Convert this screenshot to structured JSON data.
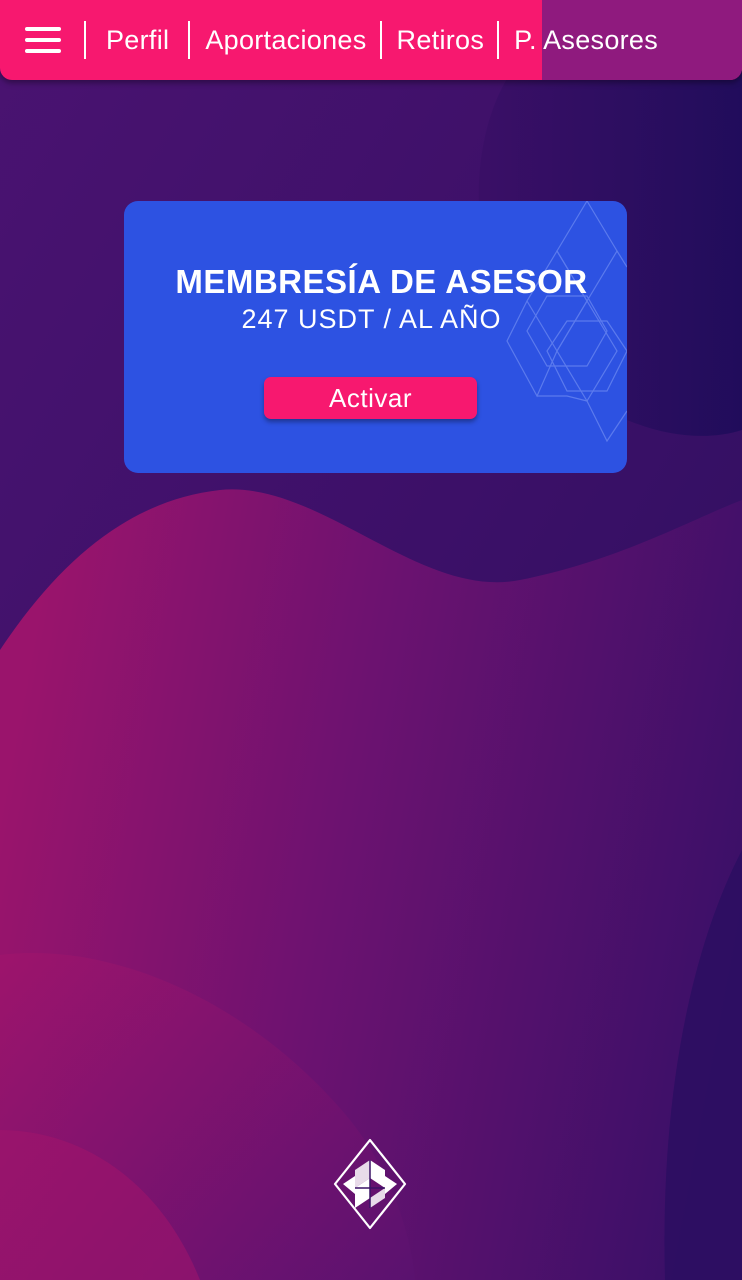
{
  "nav": {
    "menu_icon": "hamburger-menu-icon",
    "tabs": [
      {
        "label": "Perfil"
      },
      {
        "label": "Aportaciones"
      },
      {
        "label": "Retiros"
      },
      {
        "label": "P. Asesores",
        "active": true
      }
    ],
    "colors": {
      "bar": "#f7186f",
      "active_tab": "#8f1a7e"
    }
  },
  "membership_card": {
    "title": "MEMBRESÍA DE ASESOR",
    "price": "247 USDT / AL AÑO",
    "button_label": "Activar",
    "colors": {
      "card": "#2d52e2",
      "button": "#f7186f"
    }
  },
  "footer": {
    "logo_icon": "cube-diamond-logo-icon"
  },
  "theme": {
    "background_dark": "#3a1266",
    "background_pink": "#b0166e",
    "accent": "#f7186f"
  }
}
